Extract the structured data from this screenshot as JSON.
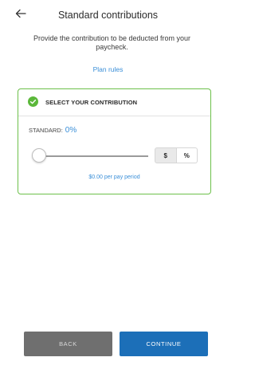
{
  "header": {
    "title": "Standard contributions",
    "back_icon": "arrow-left-icon"
  },
  "instructions": "Provide the contribution to be deducted from your paycheck.",
  "plan_rules_link": "Plan rules",
  "contribution_card": {
    "title": "SELECT YOUR CONTRIBUTION",
    "check_icon": "check-circle-icon",
    "standard_label": "STANDARD:",
    "standard_value": "0%",
    "slider_level": 0,
    "unit_toggle": {
      "dollar_label": "$",
      "percent_label": "%",
      "selected": "$"
    },
    "per_pay_period": "$0.00 per pay period"
  },
  "buttons": {
    "back_label": "BACK",
    "continue_label": "CONTINUE"
  },
  "colors": {
    "accent_blue": "#3a8fd8",
    "continue_blue": "#1c6fb8",
    "back_gray": "#6f6f6f",
    "card_border_green": "#6cc04a",
    "check_green": "#5bb83a"
  }
}
